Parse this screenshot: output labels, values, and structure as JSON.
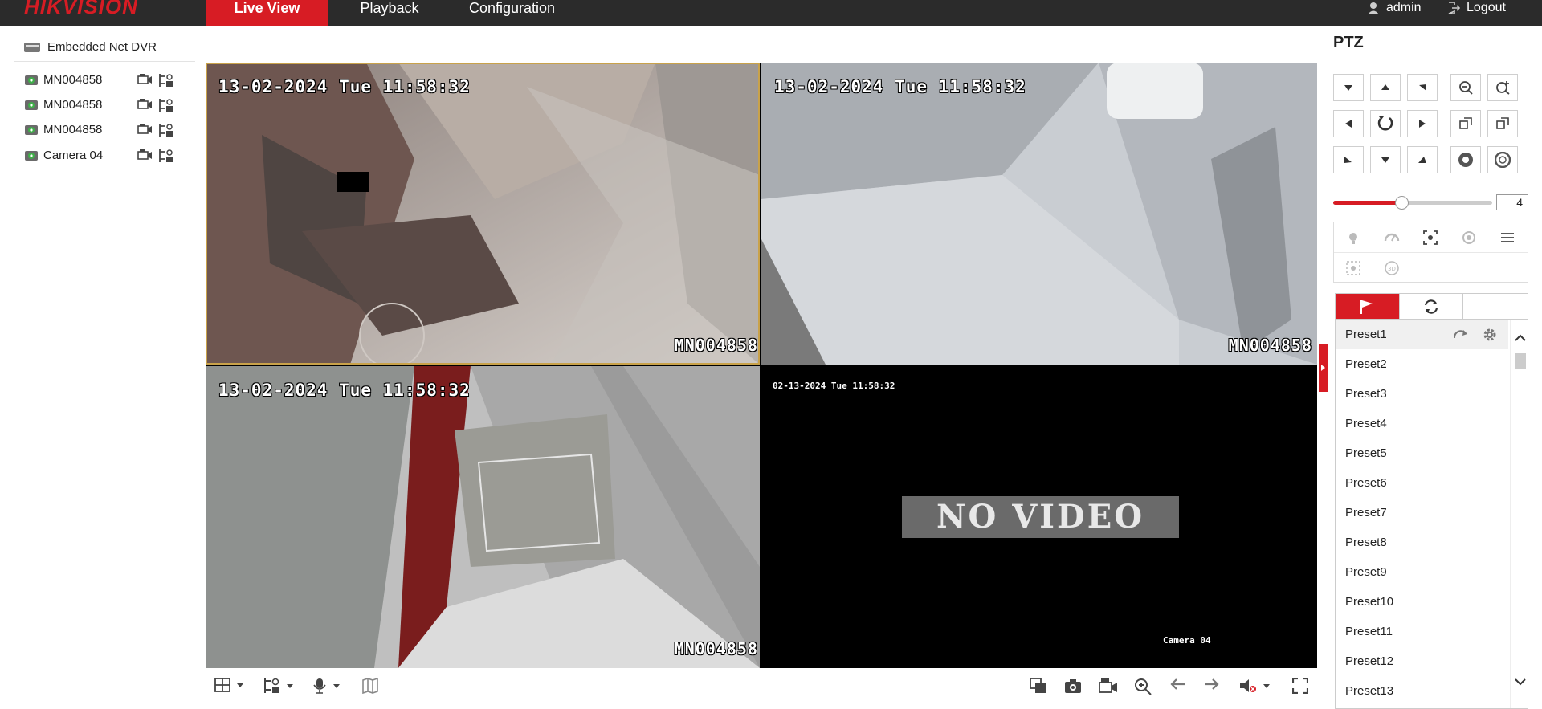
{
  "header": {
    "logo": "HIKVISION",
    "tabs": [
      {
        "label": "Live View",
        "active": true
      },
      {
        "label": "Playback",
        "active": false
      },
      {
        "label": "Configuration",
        "active": false
      }
    ],
    "user": "admin",
    "logout": "Logout"
  },
  "tree": {
    "root": "Embedded Net DVR",
    "cameras": [
      {
        "label": "MN004858"
      },
      {
        "label": "MN004858"
      },
      {
        "label": "MN004858"
      },
      {
        "label": "Camera 04"
      }
    ]
  },
  "tiles": [
    {
      "timestamp": "13-02-2024 Tue 11:58:32",
      "name": "MN004858"
    },
    {
      "timestamp": "13-02-2024 Tue 11:58:32",
      "name": "MN004858"
    },
    {
      "timestamp": "13-02-2024 Tue 11:58:32",
      "name": "MN004858"
    },
    {
      "timestamp": "02-13-2024 Tue 11:58:32",
      "name": "Camera 04",
      "no_video": "NO VIDEO"
    }
  ],
  "ptz": {
    "title": "PTZ",
    "speed": "4",
    "speed_level": 0.43,
    "presets": [
      "Preset1",
      "Preset2",
      "Preset3",
      "Preset4",
      "Preset5",
      "Preset6",
      "Preset7",
      "Preset8",
      "Preset9",
      "Preset10",
      "Preset11",
      "Preset12",
      "Preset13"
    ]
  },
  "colors": {
    "accent": "#d71c24",
    "topbar": "#2b2b2b"
  }
}
